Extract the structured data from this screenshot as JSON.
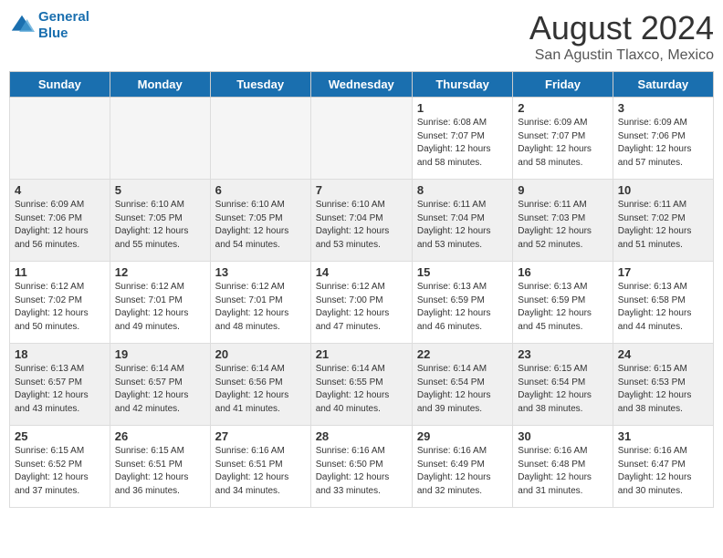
{
  "header": {
    "logo_line1": "General",
    "logo_line2": "Blue",
    "title": "August 2024",
    "subtitle": "San Agustin Tlaxco, Mexico"
  },
  "days_of_week": [
    "Sunday",
    "Monday",
    "Tuesday",
    "Wednesday",
    "Thursday",
    "Friday",
    "Saturday"
  ],
  "weeks": [
    [
      {
        "day": "",
        "info": ""
      },
      {
        "day": "",
        "info": ""
      },
      {
        "day": "",
        "info": ""
      },
      {
        "day": "",
        "info": ""
      },
      {
        "day": "1",
        "info": "Sunrise: 6:08 AM\nSunset: 7:07 PM\nDaylight: 12 hours\nand 58 minutes."
      },
      {
        "day": "2",
        "info": "Sunrise: 6:09 AM\nSunset: 7:07 PM\nDaylight: 12 hours\nand 58 minutes."
      },
      {
        "day": "3",
        "info": "Sunrise: 6:09 AM\nSunset: 7:06 PM\nDaylight: 12 hours\nand 57 minutes."
      }
    ],
    [
      {
        "day": "4",
        "info": "Sunrise: 6:09 AM\nSunset: 7:06 PM\nDaylight: 12 hours\nand 56 minutes."
      },
      {
        "day": "5",
        "info": "Sunrise: 6:10 AM\nSunset: 7:05 PM\nDaylight: 12 hours\nand 55 minutes."
      },
      {
        "day": "6",
        "info": "Sunrise: 6:10 AM\nSunset: 7:05 PM\nDaylight: 12 hours\nand 54 minutes."
      },
      {
        "day": "7",
        "info": "Sunrise: 6:10 AM\nSunset: 7:04 PM\nDaylight: 12 hours\nand 53 minutes."
      },
      {
        "day": "8",
        "info": "Sunrise: 6:11 AM\nSunset: 7:04 PM\nDaylight: 12 hours\nand 53 minutes."
      },
      {
        "day": "9",
        "info": "Sunrise: 6:11 AM\nSunset: 7:03 PM\nDaylight: 12 hours\nand 52 minutes."
      },
      {
        "day": "10",
        "info": "Sunrise: 6:11 AM\nSunset: 7:02 PM\nDaylight: 12 hours\nand 51 minutes."
      }
    ],
    [
      {
        "day": "11",
        "info": "Sunrise: 6:12 AM\nSunset: 7:02 PM\nDaylight: 12 hours\nand 50 minutes."
      },
      {
        "day": "12",
        "info": "Sunrise: 6:12 AM\nSunset: 7:01 PM\nDaylight: 12 hours\nand 49 minutes."
      },
      {
        "day": "13",
        "info": "Sunrise: 6:12 AM\nSunset: 7:01 PM\nDaylight: 12 hours\nand 48 minutes."
      },
      {
        "day": "14",
        "info": "Sunrise: 6:12 AM\nSunset: 7:00 PM\nDaylight: 12 hours\nand 47 minutes."
      },
      {
        "day": "15",
        "info": "Sunrise: 6:13 AM\nSunset: 6:59 PM\nDaylight: 12 hours\nand 46 minutes."
      },
      {
        "day": "16",
        "info": "Sunrise: 6:13 AM\nSunset: 6:59 PM\nDaylight: 12 hours\nand 45 minutes."
      },
      {
        "day": "17",
        "info": "Sunrise: 6:13 AM\nSunset: 6:58 PM\nDaylight: 12 hours\nand 44 minutes."
      }
    ],
    [
      {
        "day": "18",
        "info": "Sunrise: 6:13 AM\nSunset: 6:57 PM\nDaylight: 12 hours\nand 43 minutes."
      },
      {
        "day": "19",
        "info": "Sunrise: 6:14 AM\nSunset: 6:57 PM\nDaylight: 12 hours\nand 42 minutes."
      },
      {
        "day": "20",
        "info": "Sunrise: 6:14 AM\nSunset: 6:56 PM\nDaylight: 12 hours\nand 41 minutes."
      },
      {
        "day": "21",
        "info": "Sunrise: 6:14 AM\nSunset: 6:55 PM\nDaylight: 12 hours\nand 40 minutes."
      },
      {
        "day": "22",
        "info": "Sunrise: 6:14 AM\nSunset: 6:54 PM\nDaylight: 12 hours\nand 39 minutes."
      },
      {
        "day": "23",
        "info": "Sunrise: 6:15 AM\nSunset: 6:54 PM\nDaylight: 12 hours\nand 38 minutes."
      },
      {
        "day": "24",
        "info": "Sunrise: 6:15 AM\nSunset: 6:53 PM\nDaylight: 12 hours\nand 38 minutes."
      }
    ],
    [
      {
        "day": "25",
        "info": "Sunrise: 6:15 AM\nSunset: 6:52 PM\nDaylight: 12 hours\nand 37 minutes."
      },
      {
        "day": "26",
        "info": "Sunrise: 6:15 AM\nSunset: 6:51 PM\nDaylight: 12 hours\nand 36 minutes."
      },
      {
        "day": "27",
        "info": "Sunrise: 6:16 AM\nSunset: 6:51 PM\nDaylight: 12 hours\nand 34 minutes."
      },
      {
        "day": "28",
        "info": "Sunrise: 6:16 AM\nSunset: 6:50 PM\nDaylight: 12 hours\nand 33 minutes."
      },
      {
        "day": "29",
        "info": "Sunrise: 6:16 AM\nSunset: 6:49 PM\nDaylight: 12 hours\nand 32 minutes."
      },
      {
        "day": "30",
        "info": "Sunrise: 6:16 AM\nSunset: 6:48 PM\nDaylight: 12 hours\nand 31 minutes."
      },
      {
        "day": "31",
        "info": "Sunrise: 6:16 AM\nSunset: 6:47 PM\nDaylight: 12 hours\nand 30 minutes."
      }
    ]
  ]
}
